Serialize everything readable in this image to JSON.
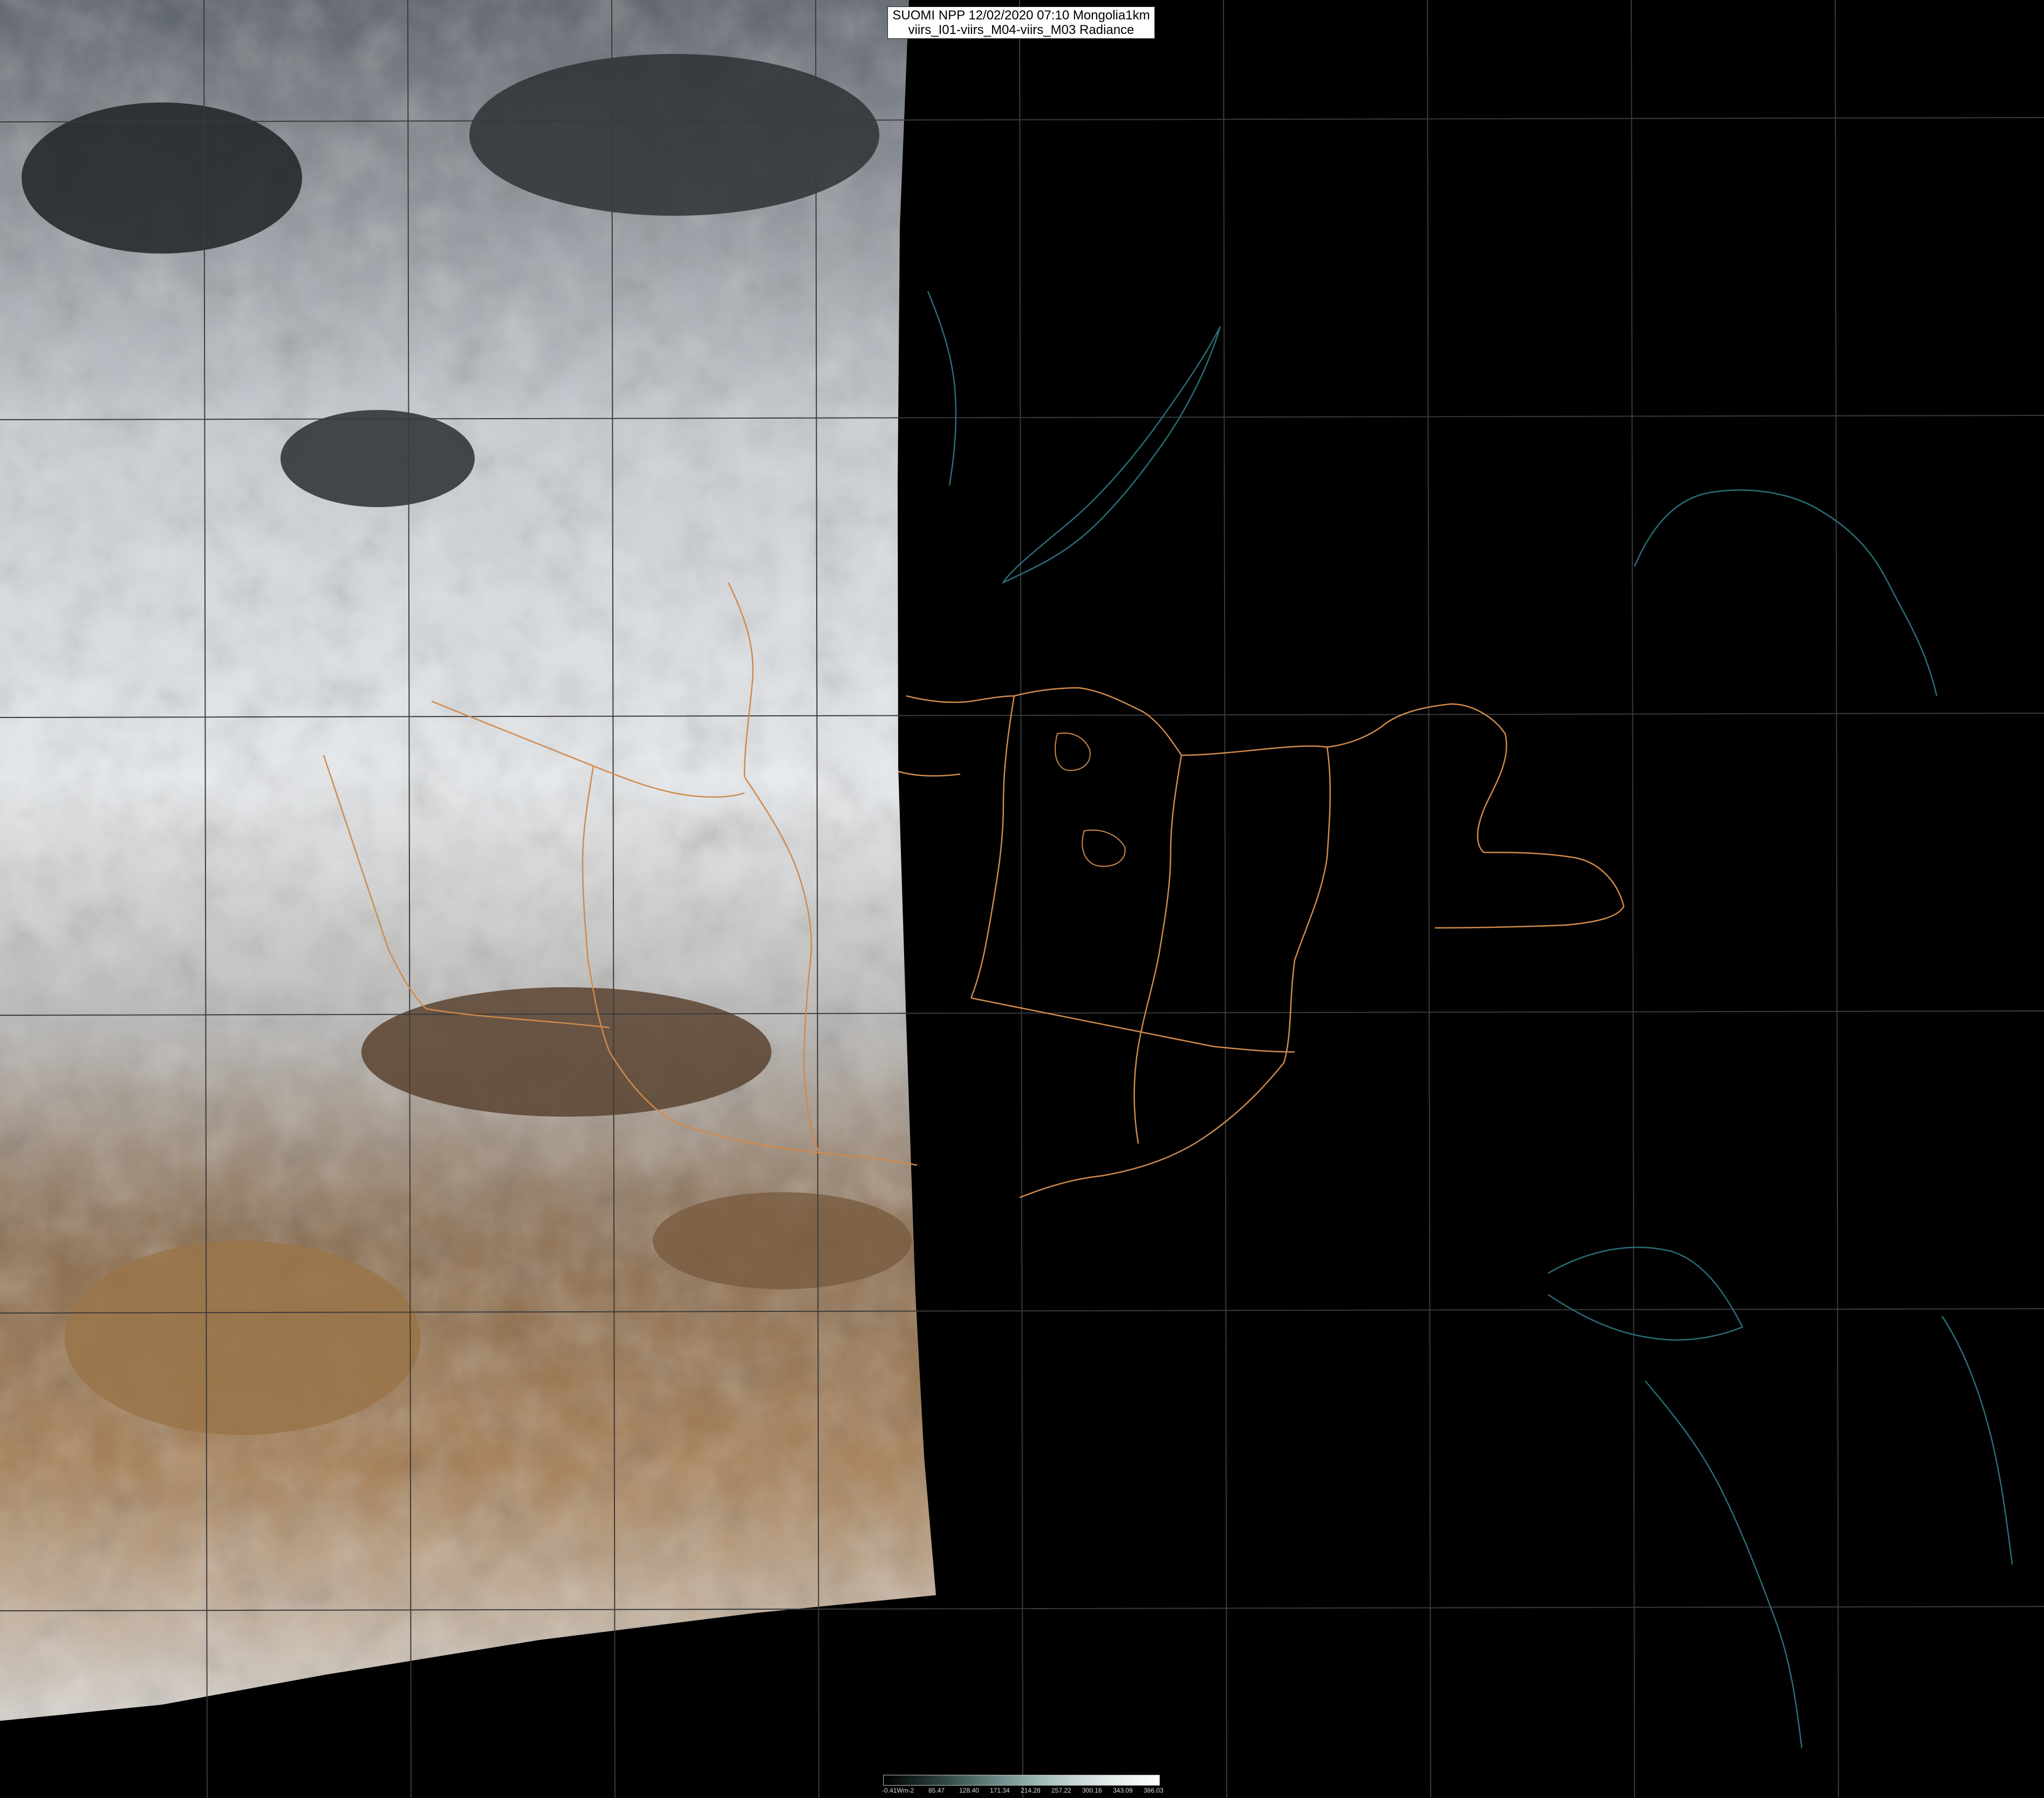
{
  "header": {
    "title_line1": "SUOMI NPP 12/02/2020 07:10 Mongolia1km",
    "title_line2": "viirs_I01-viirs_M04-viirs_M03 Radiance"
  },
  "colorbar": {
    "tick_labels": [
      "-0.41Wm-2",
      "85.47",
      "128.40",
      "171.34",
      "214.28",
      "257.22",
      "300.16",
      "343.09",
      "386.03"
    ]
  },
  "colors": {
    "background": "#000000",
    "graticule": "#3a3a3a",
    "border_lines": "#d08a4c",
    "coastline": "#2a6e78"
  }
}
